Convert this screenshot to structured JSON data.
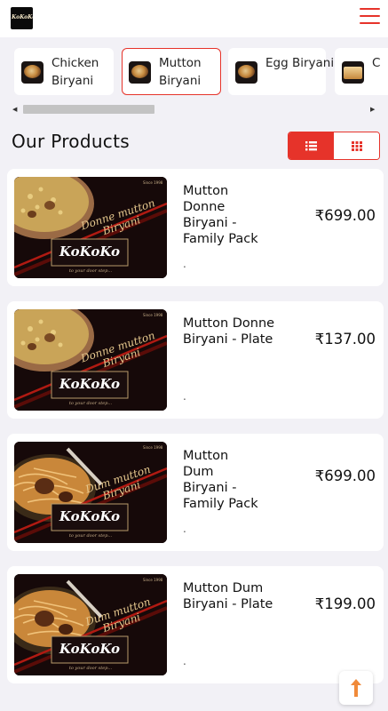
{
  "header": {
    "logo_text": "KoKoKo"
  },
  "categories": [
    {
      "label": "Chicken Biryani",
      "active": false
    },
    {
      "label": "Mutton Biryani",
      "active": true
    },
    {
      "label": "Egg Biryani",
      "active": false
    },
    {
      "label": "C",
      "active": false
    }
  ],
  "products_section": {
    "title": "Our Products",
    "view_mode": "list"
  },
  "products": [
    {
      "name": "Mutton Donne Biryani - Family Pack",
      "price": "₹699.00",
      "description": ".",
      "image": {
        "headline": "Donne mutton Biryani",
        "brand": "KoKoKo",
        "tagline": "to your door step...",
        "since": "Since 1998"
      }
    },
    {
      "name": "Mutton Donne Biryani - Plate",
      "price": "₹137.00",
      "description": ".",
      "image": {
        "headline": "Donne mutton Biryani",
        "brand": "KoKoKo",
        "tagline": "to your door step...",
        "since": "Since 1998"
      }
    },
    {
      "name": "Mutton Dum Biryani - Family Pack",
      "price": "₹699.00",
      "description": ".",
      "image": {
        "headline": "Dum mutton Biryani",
        "brand": "KoKoKo",
        "tagline": "to your door step...",
        "since": "Since 1998"
      }
    },
    {
      "name": "Mutton Dum Biryani - Plate",
      "price": "₹199.00",
      "description": ".",
      "image": {
        "headline": "Dum mutton Biryani",
        "brand": "KoKoKo",
        "tagline": "to your door step...",
        "since": "Since 1998"
      }
    }
  ],
  "colors": {
    "accent": "#e6332a",
    "background": "#f2f1f6",
    "card": "#ffffff"
  },
  "icons": {
    "menu": "hamburger-menu-icon",
    "list_view": "list-view-icon",
    "grid_view": "grid-view-icon",
    "scroll_top": "arrow-up-icon",
    "scroll_left": "scroll-left-arrow-icon",
    "scroll_right": "scroll-right-arrow-icon"
  }
}
